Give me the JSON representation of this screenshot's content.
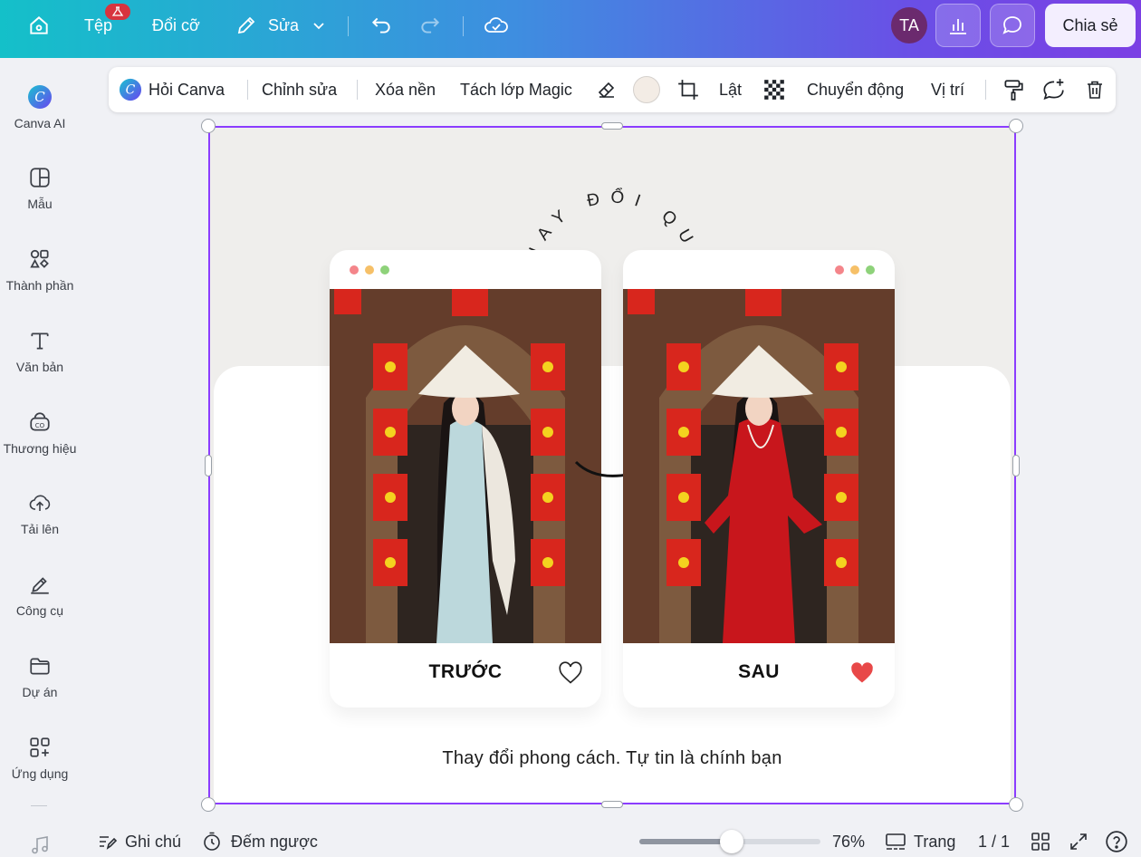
{
  "topbar": {
    "home_icon": "home-icon",
    "file_label": "Tệp",
    "resize_label": "Đổi cỡ",
    "edit_label": "Sửa",
    "undo_icon": "undo-icon",
    "redo_icon": "redo-icon",
    "sync_icon": "cloud-check-icon",
    "avatar_initials": "TA",
    "share_label": "Chia sẻ"
  },
  "sidebar": {
    "items": [
      {
        "label": "Canva AI",
        "icon": "canva-ai-icon"
      },
      {
        "label": "Mẫu",
        "icon": "template-icon"
      },
      {
        "label": "Thành phần",
        "icon": "elements-icon"
      },
      {
        "label": "Văn bản",
        "icon": "text-icon"
      },
      {
        "label": "Thương hiệu",
        "icon": "brand-icon"
      },
      {
        "label": "Tải lên",
        "icon": "upload-icon"
      },
      {
        "label": "Công cụ",
        "icon": "tools-icon"
      },
      {
        "label": "Dự án",
        "icon": "folder-icon"
      },
      {
        "label": "Ứng dụng",
        "icon": "apps-icon"
      }
    ]
  },
  "context_toolbar": {
    "ask_canva": "Hỏi Canva",
    "edit": "Chỉnh sửa",
    "remove_bg": "Xóa nền",
    "magic_layer": "Tách lớp Magic",
    "flip": "Lật",
    "animate": "Chuyển động",
    "position": "Vị trí"
  },
  "design": {
    "curved_title": "THAY ĐỔI QUẦN ÁO",
    "before_label": "TRƯỚC",
    "after_label": "SAU",
    "caption": "Thay đổi phong cách. Tự tin là chính bạn",
    "before_dress_color": "#bcd8dc",
    "after_dress_color": "#c8161c"
  },
  "bottombar": {
    "notes": "Ghi chú",
    "timer": "Đếm ngược",
    "zoom": "76%",
    "zoom_fraction": 0.51,
    "pages_label": "Trang",
    "page_count": "1 / 1"
  },
  "colors": {
    "accent": "#8b3dff",
    "heart_filled": "#e84848"
  }
}
